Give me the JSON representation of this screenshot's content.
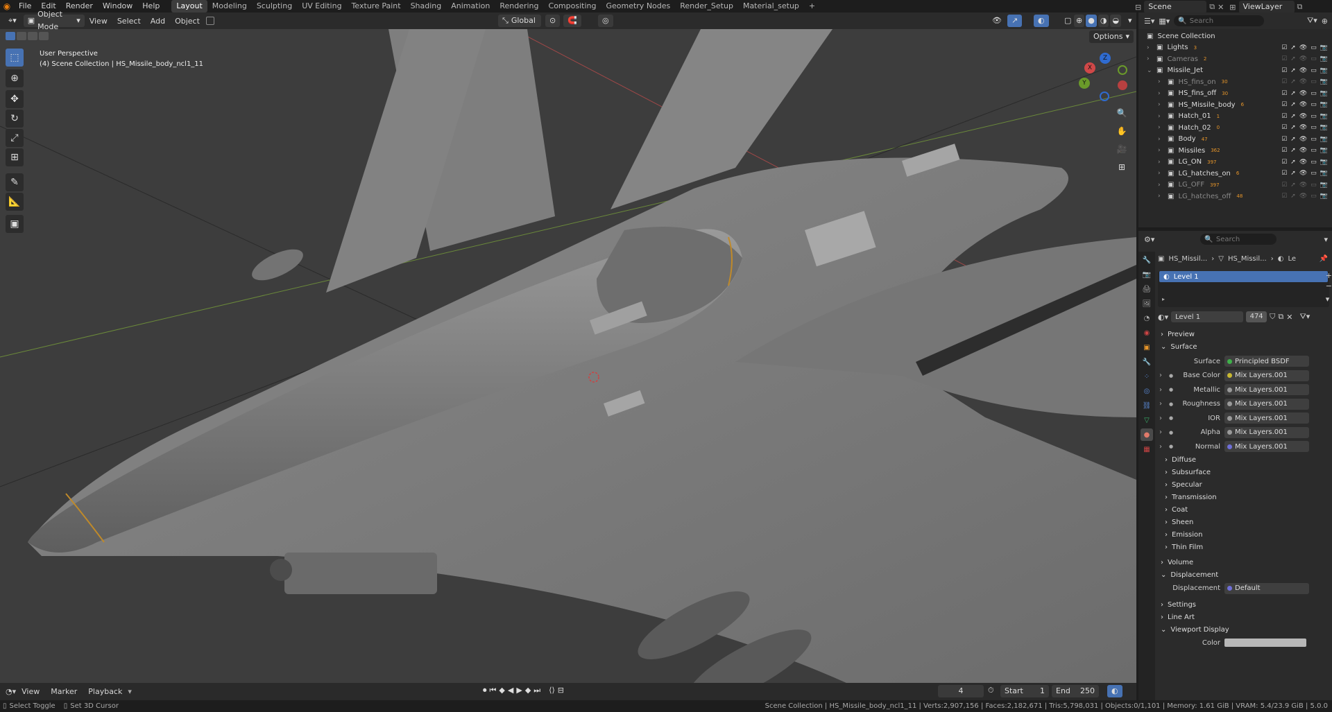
{
  "menu": [
    "File",
    "Edit",
    "Render",
    "Window",
    "Help"
  ],
  "workspaces": [
    "Layout",
    "Modeling",
    "Sculpting",
    "UV Editing",
    "Texture Paint",
    "Shading",
    "Animation",
    "Rendering",
    "Compositing",
    "Geometry Nodes",
    "Render_Setup",
    "Material_setup"
  ],
  "active_workspace": "Layout",
  "scene": "Scene",
  "view_layer": "ViewLayer",
  "viewport_header": {
    "mode": "Object Mode",
    "menus": [
      "View",
      "Select",
      "Add",
      "Object"
    ],
    "transform": "Global",
    "options": "Options"
  },
  "viewport_overlay": {
    "perspective": "User Perspective",
    "collection_info": "(4) Scene Collection | HS_Missile_body_ncl1_11"
  },
  "gizmo": {
    "x": "X",
    "y": "Y",
    "z": "Z"
  },
  "outliner": {
    "search_placeholder": "Search",
    "root": "Scene Collection",
    "items": [
      {
        "name": "Lights",
        "count": "3",
        "dim": false,
        "indent": 1
      },
      {
        "name": "Cameras",
        "count": "2",
        "dim": true,
        "indent": 1
      },
      {
        "name": "Missile_Jet",
        "count": "",
        "dim": false,
        "indent": 1
      },
      {
        "name": "HS_fins_on",
        "count": "30",
        "dim": true,
        "indent": 2
      },
      {
        "name": "HS_fins_off",
        "count": "30",
        "dim": false,
        "indent": 2
      },
      {
        "name": "HS_Missile_body",
        "count": "6",
        "dim": false,
        "indent": 2
      },
      {
        "name": "Hatch_01",
        "count": "1",
        "dim": false,
        "indent": 2
      },
      {
        "name": "Hatch_02",
        "count": "0",
        "dim": false,
        "indent": 2
      },
      {
        "name": "Body",
        "count": "47",
        "dim": false,
        "indent": 2
      },
      {
        "name": "Missiles",
        "count": "362",
        "dim": false,
        "indent": 2
      },
      {
        "name": "LG_ON",
        "count": "397",
        "dim": false,
        "indent": 2
      },
      {
        "name": "LG_hatches_on",
        "count": "6",
        "dim": false,
        "indent": 2
      },
      {
        "name": "LG_OFF",
        "count": "397",
        "dim": true,
        "indent": 2
      },
      {
        "name": "LG_hatches_off",
        "count": "48",
        "dim": true,
        "indent": 2
      }
    ]
  },
  "properties": {
    "search_placeholder": "Search",
    "breadcrumb": [
      "HS_Missil...",
      "HS_Missil...",
      "Le"
    ],
    "material_slot": "Level 1",
    "material_name": "Level 1",
    "material_users": "474",
    "sections_top": [
      "Preview",
      "Surface"
    ],
    "surface_label": "Surface",
    "surface_value": "Principled BSDF",
    "inputs": [
      {
        "label": "Base Color",
        "value": "Mix Layers.001",
        "color": "#c8b832"
      },
      {
        "label": "Metallic",
        "value": "Mix Layers.001",
        "color": "#9a9a9a"
      },
      {
        "label": "Roughness",
        "value": "Mix Layers.001",
        "color": "#9a9a9a"
      },
      {
        "label": "IOR",
        "value": "Mix Layers.001",
        "color": "#9a9a9a"
      },
      {
        "label": "Alpha",
        "value": "Mix Layers.001",
        "color": "#9a9a9a"
      },
      {
        "label": "Normal",
        "value": "Mix Layers.001",
        "color": "#6f6fd8"
      }
    ],
    "subsections": [
      "Diffuse",
      "Subsurface",
      "Specular",
      "Transmission",
      "Coat",
      "Sheen",
      "Emission",
      "Thin Film"
    ],
    "volume": "Volume",
    "displacement": "Displacement",
    "displacement_label": "Displacement",
    "displacement_value": "Default",
    "settings": "Settings",
    "line_art": "Line Art",
    "viewport_display": "Viewport Display",
    "color_label": "Color"
  },
  "timeline": {
    "menus": [
      "View",
      "Marker",
      "Playback"
    ],
    "current_frame": "4",
    "start_label": "Start",
    "start": "1",
    "end_label": "End",
    "end": "250"
  },
  "statusbar": {
    "left1": "Select Toggle",
    "left2": "Set 3D Cursor",
    "right": "Scene Collection | HS_Missile_body_ncl1_11 | Verts:2,907,156 | Faces:2,182,671 | Tris:5,798,031 | Objects:0/1,101 | Memory: 1.61 GiB | VRAM: 5.4/23.9 GiB | 5.0.0"
  },
  "colors": {
    "accent": "#4772b3",
    "bg": "#1d1d1d",
    "viewport": "#3e3e3e"
  }
}
